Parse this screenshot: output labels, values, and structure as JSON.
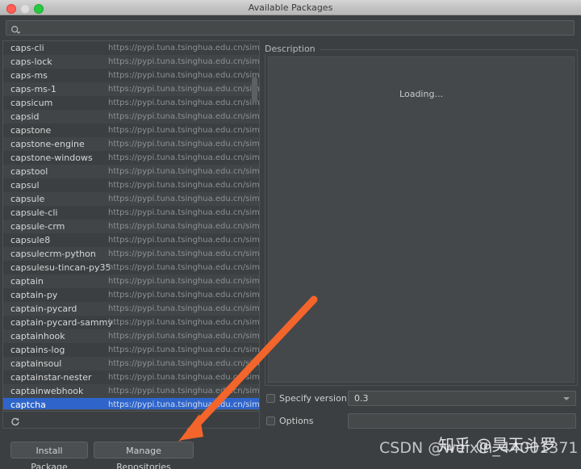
{
  "window": {
    "title": "Available Packages",
    "traffic_lights": [
      "close-button",
      "minimize-button",
      "maximize-button"
    ]
  },
  "search": {
    "value": "",
    "placeholder": "",
    "icon": "search-icon"
  },
  "package_list": {
    "repository_url": "https://pypi.tuna.tsinghua.edu.cn/simple/",
    "selected": "captcha",
    "refresh_icon": "refresh-icon",
    "items": [
      {
        "name": "caps-cli",
        "url": "https://pypi.tuna.tsinghua.edu.cn/simple/"
      },
      {
        "name": "caps-lock",
        "url": "https://pypi.tuna.tsinghua.edu.cn/simple/"
      },
      {
        "name": "caps-ms",
        "url": "https://pypi.tuna.tsinghua.edu.cn/simple/"
      },
      {
        "name": "caps-ms-1",
        "url": "https://pypi.tuna.tsinghua.edu.cn/simple/"
      },
      {
        "name": "capsicum",
        "url": "https://pypi.tuna.tsinghua.edu.cn/simple/"
      },
      {
        "name": "capsid",
        "url": "https://pypi.tuna.tsinghua.edu.cn/simple/"
      },
      {
        "name": "capstone",
        "url": "https://pypi.tuna.tsinghua.edu.cn/simple/"
      },
      {
        "name": "capstone-engine",
        "url": "https://pypi.tuna.tsinghua.edu.cn/simple/"
      },
      {
        "name": "capstone-windows",
        "url": "https://pypi.tuna.tsinghua.edu.cn/simple/"
      },
      {
        "name": "capstool",
        "url": "https://pypi.tuna.tsinghua.edu.cn/simple/"
      },
      {
        "name": "capsul",
        "url": "https://pypi.tuna.tsinghua.edu.cn/simple/"
      },
      {
        "name": "capsule",
        "url": "https://pypi.tuna.tsinghua.edu.cn/simple/"
      },
      {
        "name": "capsule-cli",
        "url": "https://pypi.tuna.tsinghua.edu.cn/simple/"
      },
      {
        "name": "capsule-crm",
        "url": "https://pypi.tuna.tsinghua.edu.cn/simple/"
      },
      {
        "name": "capsule8",
        "url": "https://pypi.tuna.tsinghua.edu.cn/simple/"
      },
      {
        "name": "capsulecrm-python",
        "url": "https://pypi.tuna.tsinghua.edu.cn/simple/"
      },
      {
        "name": "capsulesu-tincan-py35",
        "url": "https://pypi.tuna.tsinghua.edu.cn/simple/"
      },
      {
        "name": "captain",
        "url": "https://pypi.tuna.tsinghua.edu.cn/simple/"
      },
      {
        "name": "captain-py",
        "url": "https://pypi.tuna.tsinghua.edu.cn/simple/"
      },
      {
        "name": "captain-pycard",
        "url": "https://pypi.tuna.tsinghua.edu.cn/simple/"
      },
      {
        "name": "captain-pycard-sammy",
        "url": "https://pypi.tuna.tsinghua.edu.cn/simple/"
      },
      {
        "name": "captainhook",
        "url": "https://pypi.tuna.tsinghua.edu.cn/simple/"
      },
      {
        "name": "captains-log",
        "url": "https://pypi.tuna.tsinghua.edu.cn/simple/"
      },
      {
        "name": "captainsoul",
        "url": "https://pypi.tuna.tsinghua.edu.cn/simple/"
      },
      {
        "name": "captainstar-nester",
        "url": "https://pypi.tuna.tsinghua.edu.cn/simple/"
      },
      {
        "name": "captainwebhook",
        "url": "https://pypi.tuna.tsinghua.edu.cn/simple/"
      },
      {
        "name": "captcha",
        "url": "https://pypi.tuna.tsinghua.edu.cn/simple/"
      }
    ]
  },
  "description": {
    "legend": "Description",
    "body": "Loading..."
  },
  "specify_version": {
    "label": "Specify version",
    "checked": false,
    "value": "0.3"
  },
  "options": {
    "label": "Options",
    "checked": false,
    "value": "",
    "placeholder": ""
  },
  "buttons": {
    "install": "Install Package",
    "manage": "Manage Repositories"
  },
  "watermarks": {
    "csdn": "CSDN @weixin_44001371",
    "zhihu": "知乎 @昊天斗罗"
  },
  "colors": {
    "window_bg": "#3c3f41",
    "selection_blue": "#2f65ca",
    "annotation_orange": "#f4652b",
    "titlebar": "#c2c2c2"
  }
}
